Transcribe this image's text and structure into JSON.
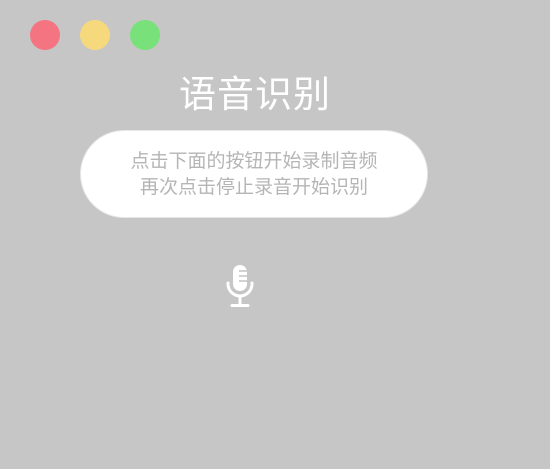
{
  "window_controls": {
    "close_color": "#f47482",
    "minimize_color": "#f7d97d",
    "maximize_color": "#79e17a"
  },
  "header": {
    "title": "语音识别"
  },
  "instructions": {
    "line1": "点击下面的按钮开始录制音频",
    "line2": "再次点击停止录音开始识别"
  },
  "record_button": {
    "icon": "microphone-icon",
    "color": "#ffffff"
  },
  "colors": {
    "background": "#c6c6c6",
    "bubble": "#ffffff",
    "bubble_text": "#b5b5b5",
    "title_text": "#ffffff"
  }
}
